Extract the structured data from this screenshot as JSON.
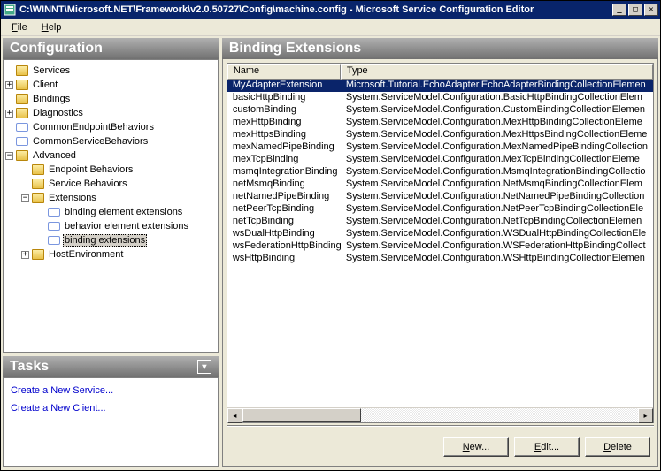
{
  "window": {
    "title": "C:\\WINNT\\Microsoft.NET\\Framework\\v2.0.50727\\Config\\machine.config - Microsoft Service Configuration Editor"
  },
  "menu": {
    "file": "File",
    "help": "Help"
  },
  "panels": {
    "config_title": "Configuration",
    "tasks_title": "Tasks",
    "right_title": "Binding Extensions"
  },
  "tree": {
    "services": "Services",
    "client": "Client",
    "bindings": "Bindings",
    "diagnostics": "Diagnostics",
    "commonEndpointBehaviors": "CommonEndpointBehaviors",
    "commonServiceBehaviors": "CommonServiceBehaviors",
    "advanced": "Advanced",
    "endpointBehaviors": "Endpoint Behaviors",
    "serviceBehaviors": "Service Behaviors",
    "extensions": "Extensions",
    "bindingElementExtensions": "binding element extensions",
    "behaviorElementExtensions": "behavior element extensions",
    "bindingExtensions": "binding extensions",
    "hostEnvironment": "HostEnvironment"
  },
  "tasks": {
    "newService": "Create a New Service...",
    "newClient": "Create a New Client..."
  },
  "list": {
    "col_name": "Name",
    "col_type": "Type",
    "rows": [
      {
        "name": "MyAdapterExtension",
        "type": "Microsoft.Tutorial.EchoAdapter.EchoAdapterBindingCollectionElemen",
        "selected": true
      },
      {
        "name": "basicHttpBinding",
        "type": "System.ServiceModel.Configuration.BasicHttpBindingCollectionElem"
      },
      {
        "name": "customBinding",
        "type": "System.ServiceModel.Configuration.CustomBindingCollectionElemen"
      },
      {
        "name": "mexHttpBinding",
        "type": "System.ServiceModel.Configuration.MexHttpBindingCollectionEleme"
      },
      {
        "name": "mexHttpsBinding",
        "type": "System.ServiceModel.Configuration.MexHttpsBindingCollectionEleme"
      },
      {
        "name": "mexNamedPipeBinding",
        "type": "System.ServiceModel.Configuration.MexNamedPipeBindingCollection"
      },
      {
        "name": "mexTcpBinding",
        "type": "System.ServiceModel.Configuration.MexTcpBindingCollectionEleme"
      },
      {
        "name": "msmqIntegrationBinding",
        "type": "System.ServiceModel.Configuration.MsmqIntegrationBindingCollectio"
      },
      {
        "name": "netMsmqBinding",
        "type": "System.ServiceModel.Configuration.NetMsmqBindingCollectionElem"
      },
      {
        "name": "netNamedPipeBinding",
        "type": "System.ServiceModel.Configuration.NetNamedPipeBindingCollection"
      },
      {
        "name": "netPeerTcpBinding",
        "type": "System.ServiceModel.Configuration.NetPeerTcpBindingCollectionEle"
      },
      {
        "name": "netTcpBinding",
        "type": "System.ServiceModel.Configuration.NetTcpBindingCollectionElemen"
      },
      {
        "name": "wsDualHttpBinding",
        "type": "System.ServiceModel.Configuration.WSDualHttpBindingCollectionEle"
      },
      {
        "name": "wsFederationHttpBinding",
        "type": "System.ServiceModel.Configuration.WSFederationHttpBindingCollect"
      },
      {
        "name": "wsHttpBinding",
        "type": "System.ServiceModel.Configuration.WSHttpBindingCollectionElemen"
      }
    ]
  },
  "buttons": {
    "new": "New...",
    "edit": "Edit...",
    "delete": "Delete"
  }
}
